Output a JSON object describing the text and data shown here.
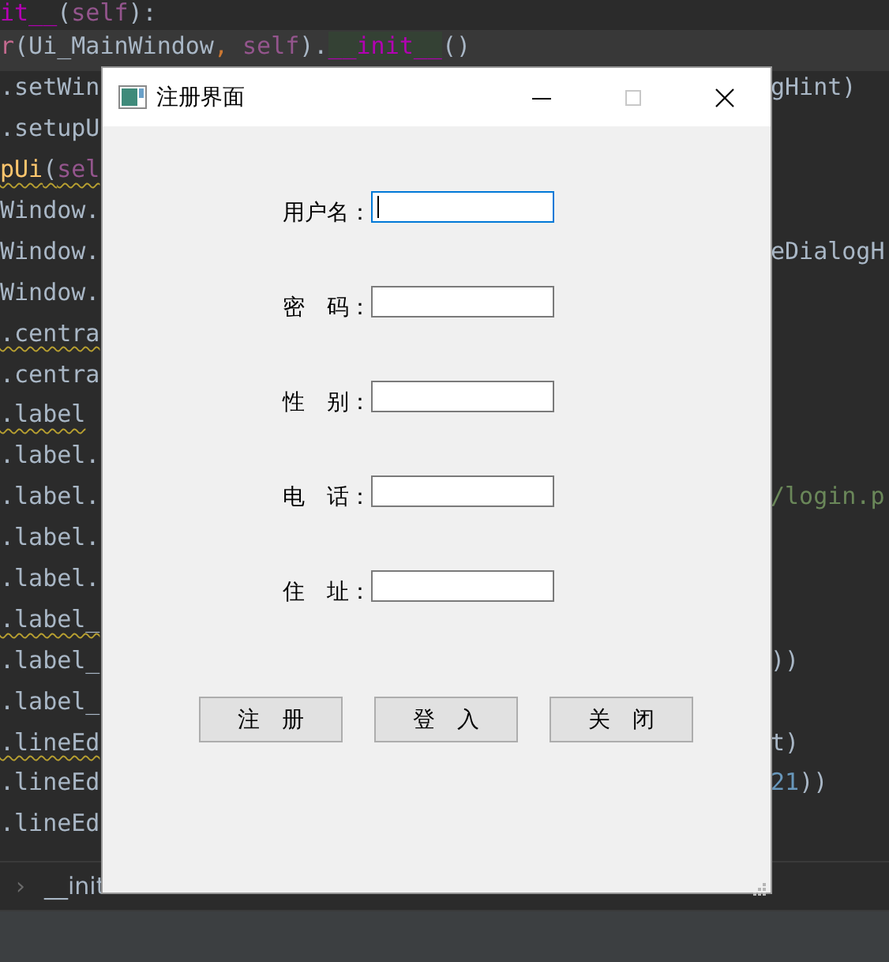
{
  "editor": {
    "lines": [
      {
        "current": false,
        "warning": false,
        "left": [
          {
            "kind": "magic",
            "text": "it__"
          },
          {
            "kind": "plain",
            "text": "("
          },
          {
            "kind": "self",
            "text": "self"
          },
          {
            "kind": "plain",
            "text": "):"
          }
        ]
      },
      {
        "current": true,
        "warning": false,
        "left": [
          {
            "kind": "builtin",
            "text": "r"
          },
          {
            "kind": "plain",
            "text": "(Ui_MainWindow"
          },
          {
            "kind": "punct",
            "text": ", "
          },
          {
            "kind": "self",
            "text": "self"
          },
          {
            "kind": "plain",
            "text": ")."
          },
          {
            "kind": "match",
            "text": "__init__"
          },
          {
            "kind": "plain",
            "text": "()"
          }
        ]
      },
      {
        "current": false,
        "warning": false,
        "left": [
          {
            "kind": "plain",
            "text": ".setWin"
          }
        ],
        "right": [
          {
            "kind": "plain",
            "text": "gHint)"
          }
        ]
      },
      {
        "current": false,
        "warning": false,
        "left": [
          {
            "kind": "plain",
            "text": ".setupU"
          }
        ]
      },
      {
        "current": false,
        "warning": true,
        "left": [
          {
            "kind": "func",
            "text": "pUi"
          },
          {
            "kind": "plain",
            "text": "("
          },
          {
            "kind": "self",
            "text": "sel"
          }
        ]
      },
      {
        "current": false,
        "warning": false,
        "left": [
          {
            "kind": "plain",
            "text": "Window."
          }
        ]
      },
      {
        "current": false,
        "warning": false,
        "left": [
          {
            "kind": "plain",
            "text": "Window."
          }
        ],
        "right": [
          {
            "kind": "plain",
            "text": "eDialogH"
          }
        ]
      },
      {
        "current": false,
        "warning": false,
        "left": [
          {
            "kind": "plain",
            "text": "Window."
          }
        ]
      },
      {
        "current": false,
        "warning": true,
        "left": [
          {
            "kind": "plain",
            "text": ".centra"
          }
        ]
      },
      {
        "current": false,
        "warning": false,
        "left": [
          {
            "kind": "plain",
            "text": ".centra"
          }
        ]
      },
      {
        "current": false,
        "warning": true,
        "left": [
          {
            "kind": "plain",
            "text": ".label"
          }
        ]
      },
      {
        "current": false,
        "warning": false,
        "left": [
          {
            "kind": "plain",
            "text": ".label."
          }
        ]
      },
      {
        "current": false,
        "warning": false,
        "left": [
          {
            "kind": "plain",
            "text": ".label."
          }
        ],
        "right": [
          {
            "kind": "string",
            "text": "/login.p"
          }
        ]
      },
      {
        "current": false,
        "warning": false,
        "left": [
          {
            "kind": "plain",
            "text": ".label."
          }
        ]
      },
      {
        "current": false,
        "warning": false,
        "left": [
          {
            "kind": "plain",
            "text": ".label."
          }
        ]
      },
      {
        "current": false,
        "warning": true,
        "left": [
          {
            "kind": "plain",
            "text": ".label_"
          }
        ]
      },
      {
        "current": false,
        "warning": false,
        "left": [
          {
            "kind": "plain",
            "text": ".label_"
          }
        ],
        "right": [
          {
            "kind": "plain",
            "text": "))"
          }
        ]
      },
      {
        "current": false,
        "warning": false,
        "left": [
          {
            "kind": "plain",
            "text": ".label_"
          }
        ]
      },
      {
        "current": false,
        "warning": true,
        "left": [
          {
            "kind": "plain",
            "text": ".lineEd"
          }
        ],
        "right": [
          {
            "kind": "plain",
            "text": "t)"
          }
        ]
      },
      {
        "current": false,
        "warning": false,
        "left": [
          {
            "kind": "plain",
            "text": ".lineEd"
          }
        ],
        "right": [
          {
            "kind": "number",
            "text": "21"
          },
          {
            "kind": "plain",
            "text": "))"
          }
        ]
      },
      {
        "current": false,
        "warning": false,
        "left": [
          {
            "kind": "plain",
            "text": ".lineEd"
          }
        ]
      }
    ]
  },
  "breadcrumb": {
    "separator": "›",
    "item": "__init"
  },
  "dialog": {
    "title": "注册界面",
    "fields": [
      {
        "label": "用户名：",
        "focused": true
      },
      {
        "label": "密　码：",
        "focused": false
      },
      {
        "label": "性　别：",
        "focused": false
      },
      {
        "label": "电　话：",
        "focused": false
      },
      {
        "label": "住　址：",
        "focused": false
      }
    ],
    "buttons": [
      "注　册",
      "登　入",
      "关　闭"
    ]
  }
}
